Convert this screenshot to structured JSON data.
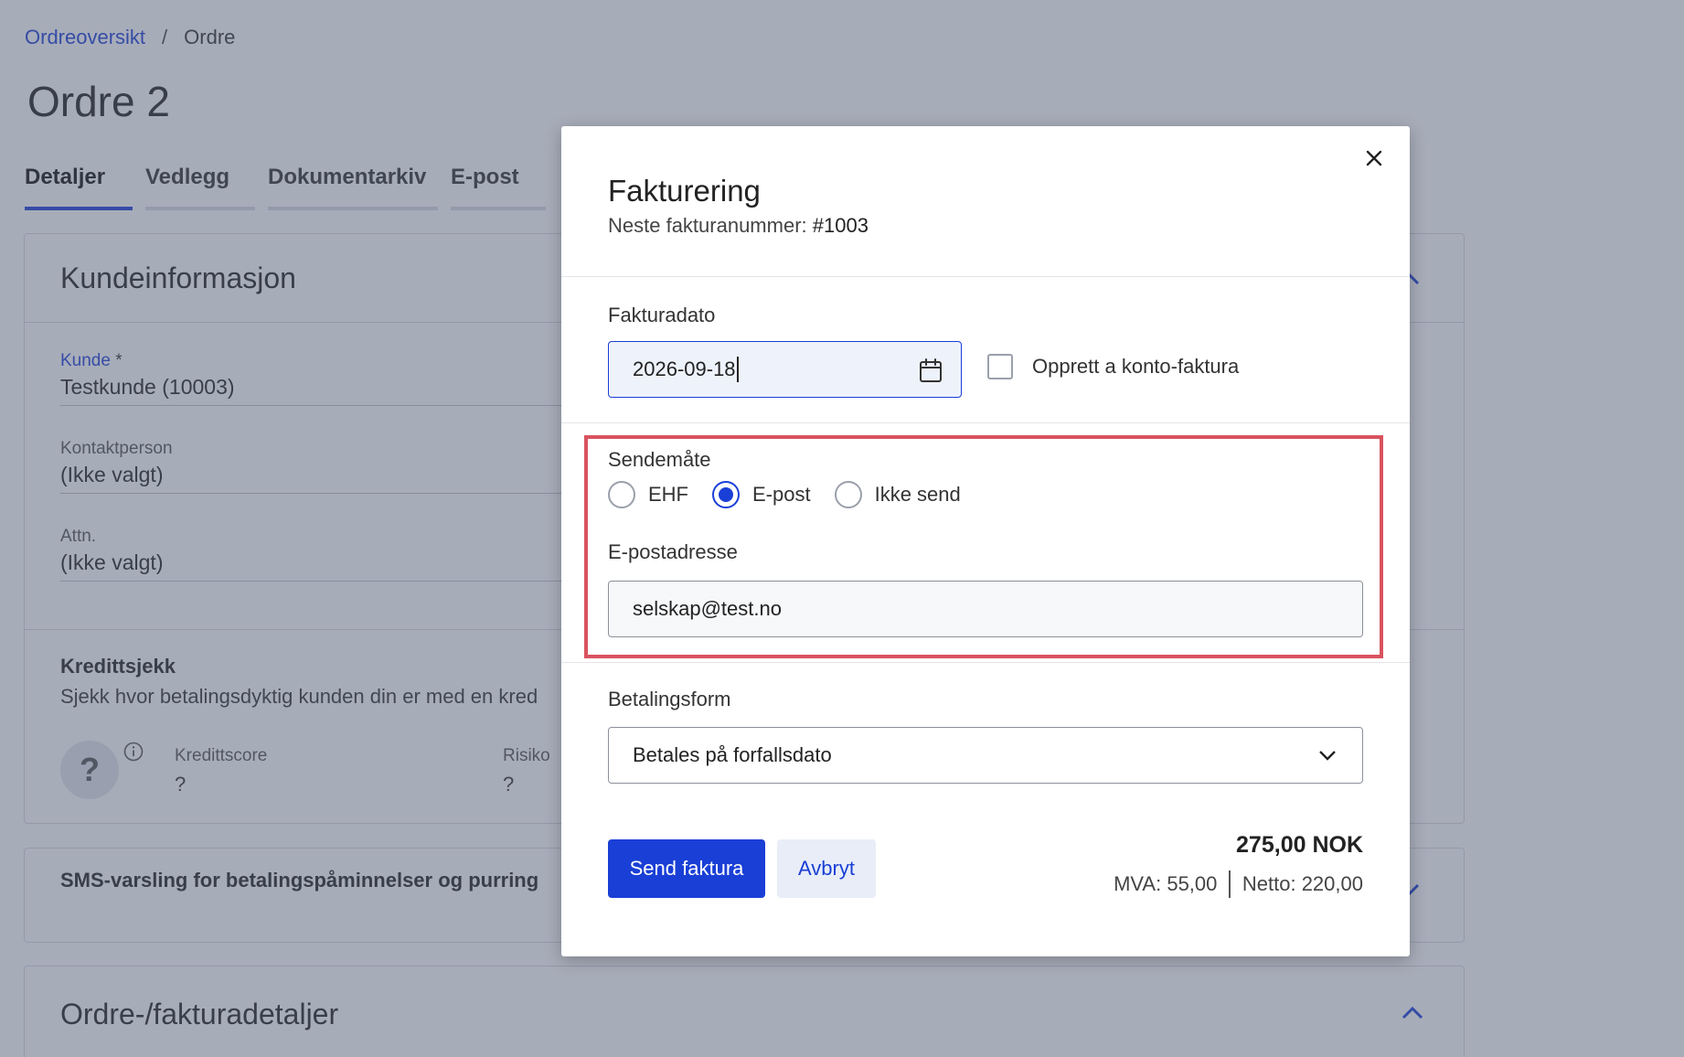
{
  "breadcrumb": {
    "link": "Ordreoversikt",
    "separator": "/",
    "current": "Ordre"
  },
  "page_title": "Ordre 2",
  "tabs": [
    {
      "label": "Detaljer",
      "active": true
    },
    {
      "label": "Vedlegg",
      "active": false
    },
    {
      "label": "Dokumentarkiv",
      "active": false
    },
    {
      "label": "E-post",
      "active": false
    }
  ],
  "customer_card": {
    "title": "Kundeinformasjon",
    "fields": [
      {
        "label": "Kunde",
        "required_mark": "*",
        "value": "Testkunde (10003)"
      },
      {
        "label": "Kontaktperson",
        "value": "(Ikke valgt)"
      },
      {
        "label": "Attn.",
        "value": "(Ikke valgt)"
      }
    ],
    "credit": {
      "title": "Kredittsjekk",
      "description": "Sjekk hvor betalingsdyktig kunden din er med en kred",
      "badge": "?",
      "score_label": "Kredittscore",
      "score_value": "?",
      "risk_label": "Risiko",
      "risk_value": "?"
    }
  },
  "sms_card": {
    "title": "SMS-varsling for betalingspåminnelser og purring"
  },
  "order_card": {
    "title": "Ordre-/fakturadetaljer"
  },
  "modal": {
    "title": "Fakturering",
    "subtitle_label": "Neste fakturanummer:",
    "subtitle_value": "#1003",
    "invoice_date_label": "Fakturadato",
    "invoice_date_value": "2026-09-18",
    "aconto_label": "Opprett a konto-faktura",
    "aconto_checked": false,
    "send_method_label": "Sendemåte",
    "send_methods": [
      {
        "label": "EHF",
        "checked": false
      },
      {
        "label": "E-post",
        "checked": true
      },
      {
        "label": "Ikke send",
        "checked": false
      }
    ],
    "email_label": "E-postadresse",
    "email_value": "selskap@test.no",
    "payment_label": "Betalingsform",
    "payment_value": "Betales på forfallsdato",
    "send_button": "Send faktura",
    "cancel_button": "Avbryt",
    "total": "275,00 NOK",
    "vat": "MVA: 55,00",
    "net": "Netto: 220,00"
  },
  "colors": {
    "accent": "#1a3fd6",
    "highlight_border": "#d9535e",
    "overlay": "rgba(80, 90, 115, 0.5)"
  }
}
